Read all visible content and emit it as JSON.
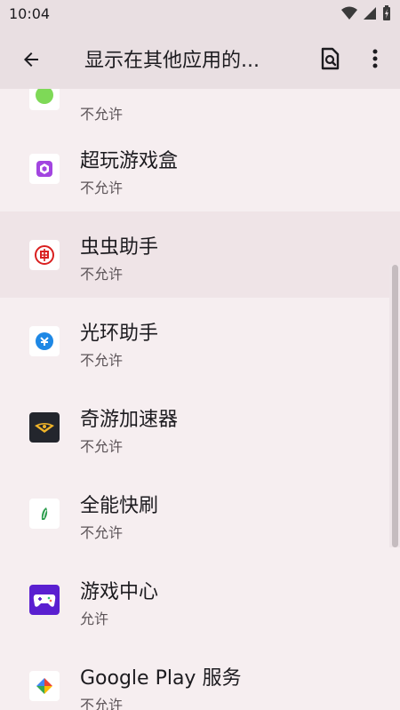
{
  "status_bar": {
    "time": "10:04"
  },
  "app_bar": {
    "title": "显示在其他应用的...",
    "back_icon": "arrow-back-icon",
    "search_icon": "search-settings-icon",
    "more_icon": "more-vert-icon"
  },
  "apps": [
    {
      "title": "",
      "status": "不允许",
      "icon": "green-app-icon"
    },
    {
      "title": "超玩游戏盒",
      "status": "不允许",
      "icon": "purple-cube-icon"
    },
    {
      "title": "虫虫助手",
      "status": "不允许",
      "icon": "red-bug-icon"
    },
    {
      "title": "光环助手",
      "status": "不允许",
      "icon": "blue-halo-icon"
    },
    {
      "title": "奇游加速器",
      "status": "不允许",
      "icon": "qiyou-wings-icon"
    },
    {
      "title": "全能快刷",
      "status": "不允许",
      "icon": "green-leaf-icon"
    },
    {
      "title": "游戏中心",
      "status": "允许",
      "icon": "gamepad-icon"
    },
    {
      "title": "Google Play 服务",
      "status": "不允许",
      "icon": "puzzle-piece-icon"
    }
  ],
  "colors": {
    "background": "#f6eef0",
    "app_bar": "#e9dfe2",
    "highlight_row": "#efe4e7",
    "primary_text": "#1c1b1f",
    "secondary_text": "#5c5458"
  }
}
